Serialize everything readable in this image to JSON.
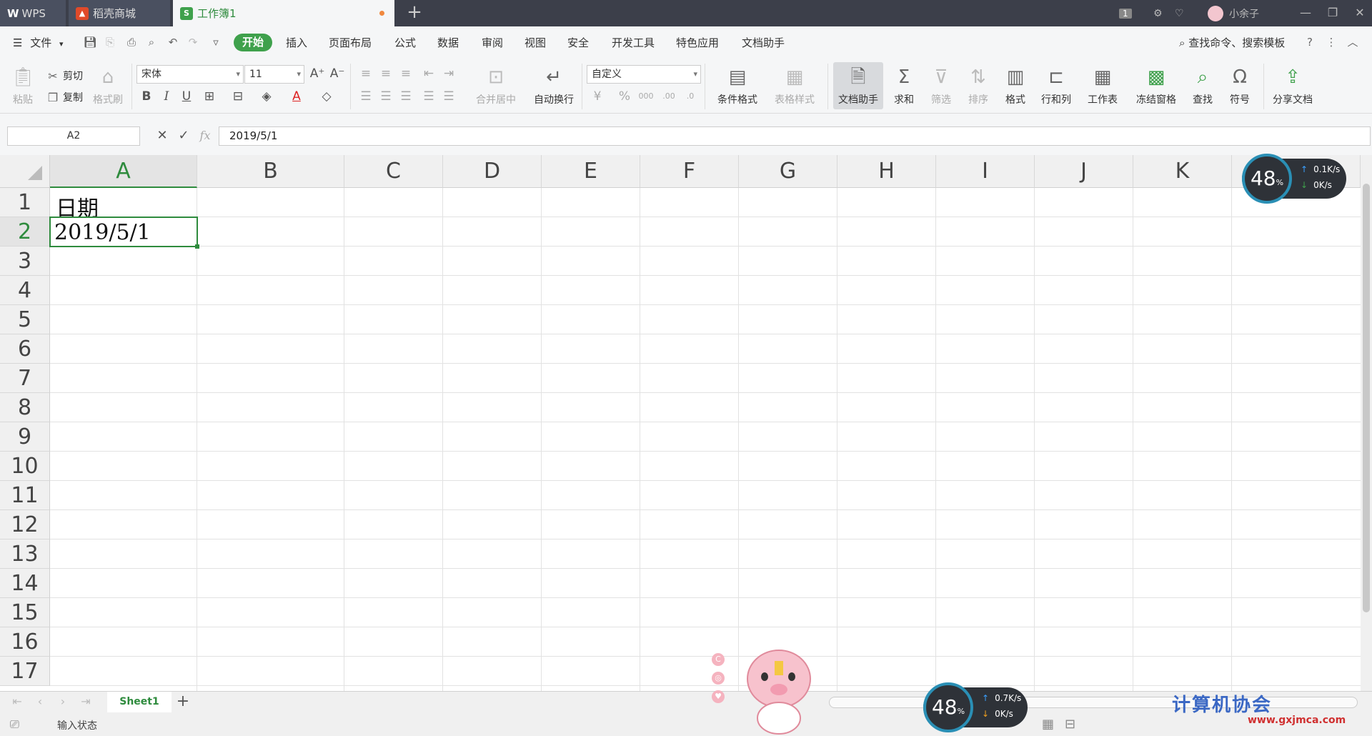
{
  "titlebar": {
    "wps_label": "WPS",
    "store_tab": "稻壳商城",
    "doc_tab": "工作簿1",
    "page_badge": "1",
    "user_name": "小余子"
  },
  "menu": {
    "file": "文件",
    "start": "开始",
    "items": [
      "插入",
      "页面布局",
      "公式",
      "数据",
      "审阅",
      "视图",
      "安全",
      "开发工具",
      "特色应用",
      "文档助手"
    ],
    "search": "查找命令、搜索模板"
  },
  "ribbon": {
    "paste": "粘贴",
    "cut": "剪切",
    "copy": "复制",
    "format_painter": "格式刷",
    "font_name": "宋体",
    "font_size": "11",
    "merge_center": "合并居中",
    "wrap": "自动换行",
    "number_format": "自定义",
    "cond_format": "条件格式",
    "table_style": "表格样式",
    "doc_helper": "文档助手",
    "sum": "求和",
    "filter": "筛选",
    "sort": "排序",
    "format": "格式",
    "row_col": "行和列",
    "worksheet": "工作表",
    "freeze": "冻结窗格",
    "find": "查找",
    "symbol": "符号",
    "share": "分享文档"
  },
  "formula_bar": {
    "cell_ref": "A2",
    "fx": "fx",
    "value": "2019/5/1"
  },
  "grid": {
    "columns": [
      "A",
      "B",
      "C",
      "D",
      "E",
      "F",
      "G",
      "H",
      "I",
      "J",
      "K"
    ],
    "rows": [
      "1",
      "2",
      "3",
      "4",
      "5",
      "6",
      "7",
      "8",
      "9",
      "10",
      "11",
      "12",
      "13",
      "14",
      "15",
      "16",
      "17"
    ],
    "selected_column": "A",
    "selected_row": "2",
    "cells": {
      "A1": "日期",
      "A2": "2019/5/1"
    }
  },
  "sheets": {
    "tabs": [
      "Sheet1"
    ],
    "active": "Sheet1"
  },
  "status": {
    "text": "输入状态"
  },
  "net_meter_top": {
    "percent": "48",
    "unit": "%",
    "up": "0.1K/s",
    "down": "0K/s"
  },
  "net_meter_bottom": {
    "percent": "48",
    "unit": "%",
    "up": "0.7K/s",
    "down": "0K/s"
  },
  "watermark": {
    "title": "计算机协会",
    "url": "www.gxjmca.com"
  },
  "colors": {
    "accent": "#2e8b3d",
    "start_btn": "#3fa14c",
    "titlebar": "#3c3f4a"
  }
}
